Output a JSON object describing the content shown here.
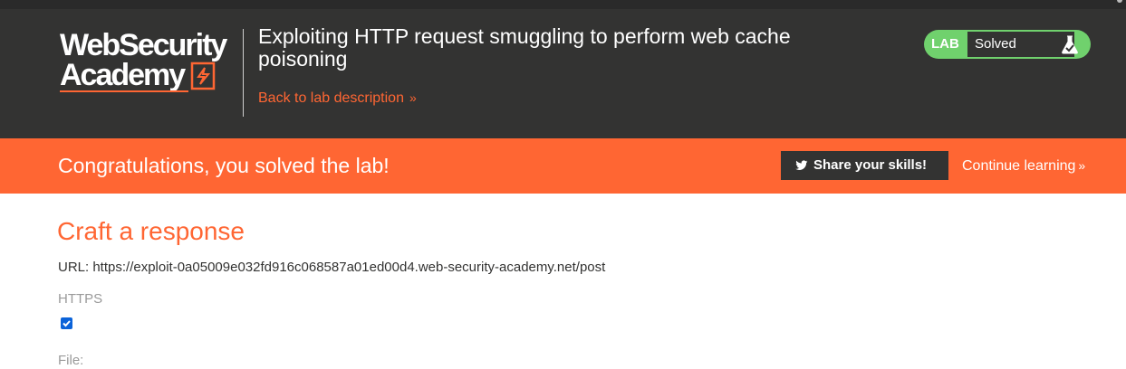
{
  "logo": {
    "line1": "WebSecurity",
    "line2": "Academy"
  },
  "header": {
    "title": "Exploiting HTTP request smuggling to perform web cache poisoning",
    "back_link": "Back to lab description",
    "back_chevron": "»"
  },
  "lab_badge": {
    "label": "LAB",
    "status": "Solved",
    "icon": "flask-icon"
  },
  "banner": {
    "message": "Congratulations, you solved the lab!",
    "share_button": "Share your skills!",
    "share_icon": "twitter-icon",
    "continue_link": "Continue learning",
    "continue_chevron": "»"
  },
  "main": {
    "title": "Craft a response",
    "url_line": "URL: https://exploit-0a05009e032fd916c068587a01ed00d4.web-security-academy.net/post",
    "https_label": "HTTPS",
    "https_checked": true,
    "file_label": "File:"
  },
  "colors": {
    "header_bg": "#333332",
    "accent": "#ff6633",
    "lab_green": "#70d16d",
    "checkbox_blue": "#0b63d9"
  }
}
